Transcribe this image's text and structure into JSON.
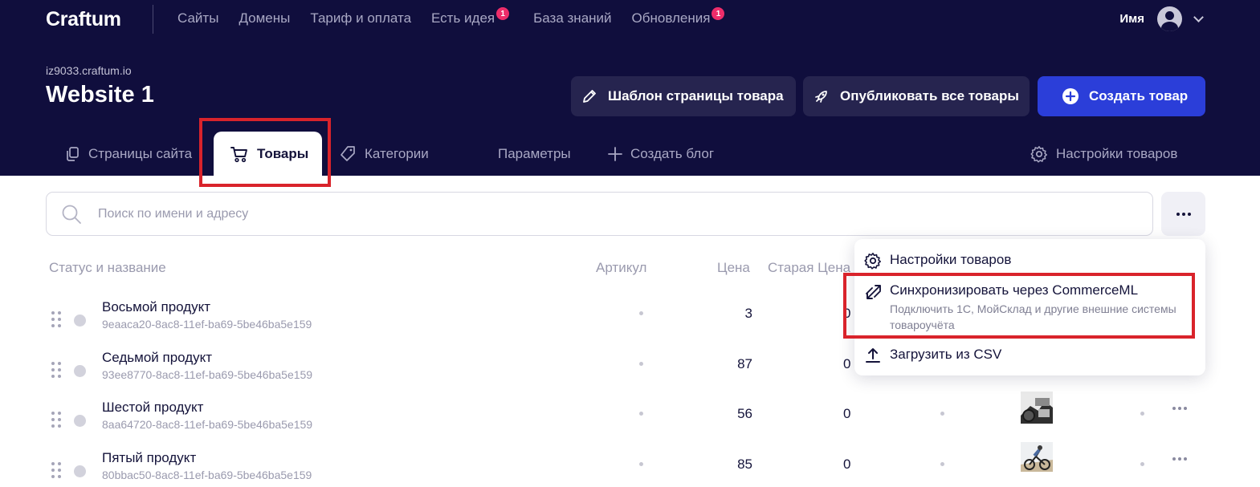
{
  "header": {
    "logo": "Craftum",
    "nav": [
      {
        "label": "Сайты",
        "badge": ""
      },
      {
        "label": "Домены",
        "badge": ""
      },
      {
        "label": "Тариф и оплата",
        "badge": ""
      },
      {
        "label": "Есть идея",
        "badge": "1"
      },
      {
        "label": "База знаний",
        "badge": ""
      },
      {
        "label": "Обновления",
        "badge": "1"
      }
    ],
    "user_name": "Имя",
    "site_domain": "iz9033.craftum.io",
    "site_title": "Website 1",
    "buttons": {
      "template": "Шаблон страницы товара",
      "publish": "Опубликовать все товары",
      "create": "Создать товар"
    },
    "tabs": {
      "pages": "Страницы сайта",
      "products": "Товары",
      "categories": "Категории",
      "parameters": "Параметры",
      "create_blog": "Создать блог",
      "product_settings": "Настройки товаров"
    }
  },
  "search": {
    "placeholder": "Поиск по имени и адресу"
  },
  "table": {
    "columns": {
      "status_name": "Статус и название",
      "sku": "Артикул",
      "price": "Цена",
      "old_price": "Старая Цена"
    },
    "rows": [
      {
        "name": "Восьмой продукт",
        "id": "9eaaca20-8ac8-11ef-ba69-5be46ba5e159",
        "price": "3",
        "old_price": "0"
      },
      {
        "name": "Седьмой продукт",
        "id": "93ee8770-8ac8-11ef-ba69-5be46ba5e159",
        "price": "87",
        "old_price": "0"
      },
      {
        "name": "Шестой продукт",
        "id": "8aa64720-8ac8-11ef-ba69-5be46ba5e159",
        "price": "56",
        "old_price": "0"
      },
      {
        "name": "Пятый продукт",
        "id": "80bbac50-8ac8-11ef-ba69-5be46ba5e159",
        "price": "85",
        "old_price": "0"
      }
    ]
  },
  "menu": {
    "items": [
      {
        "label": "Настройки товаров",
        "desc": ""
      },
      {
        "label": "Синхронизировать через CommerceML",
        "desc": "Подключить 1С, МойСклад и другие внешние системы товароучёта"
      },
      {
        "label": "Загрузить из CSV",
        "desc": ""
      }
    ]
  },
  "colors": {
    "header_bg": "#100e3d",
    "primary": "#2b3ed9",
    "highlight": "#d9232b",
    "badge": "#ee2d6a"
  }
}
